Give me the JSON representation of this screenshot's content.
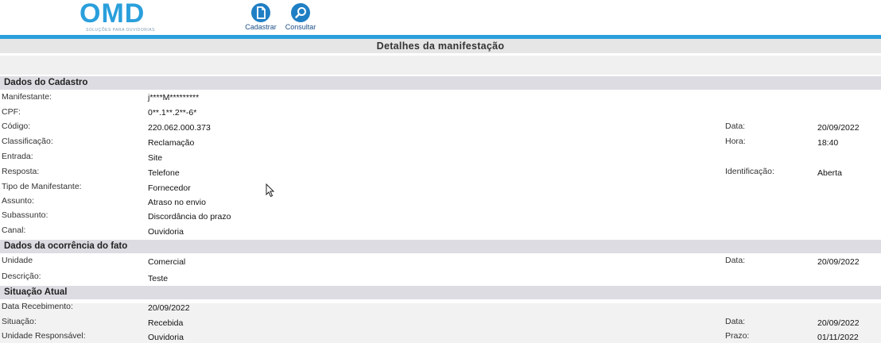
{
  "header": {
    "logo_text": "OMD",
    "logo_subtitle": "SOLUÇÕES PARA OUVIDORIAS",
    "nav": [
      {
        "label": "Cadastrar",
        "icon": "document-icon"
      },
      {
        "label": "Consultar",
        "icon": "search-icon"
      }
    ]
  },
  "colors": {
    "accent": "#2a9fdc",
    "nav_icon": "#1f7fc4",
    "section_bg": "#dcdce2"
  },
  "page_title": "Detalhes da manifestação",
  "sections": {
    "cadastro": {
      "title": "Dados do Cadastro",
      "rows": [
        {
          "label": "Manifestante:",
          "value": "j****M*********"
        },
        {
          "label": "CPF:",
          "value": "0**.1**.2**-6*"
        },
        {
          "label": "Código:",
          "value": "220.062.000.373"
        },
        {
          "label": "Classificação:",
          "value": "Reclamação"
        },
        {
          "label": "Entrada:",
          "value": "Site"
        },
        {
          "label": "Resposta:",
          "value": "Telefone"
        },
        {
          "label": "Tipo de Manifestante:",
          "value": "Fornecedor"
        },
        {
          "label": "Assunto:",
          "value": "Atraso no envio"
        },
        {
          "label": "Subassunto:",
          "value": "Discordância do prazo"
        },
        {
          "label": "Canal:",
          "value": "Ouvidoria"
        }
      ],
      "side": [
        {
          "label": "Data:",
          "value": "20/09/2022"
        },
        {
          "label": "Hora:",
          "value": "18:40"
        },
        {
          "label": "Identificação:",
          "value": "Aberta"
        }
      ]
    },
    "ocorrencia": {
      "title": "Dados da ocorrência do fato",
      "rows": [
        {
          "label": "Unidade",
          "value": "Comercial"
        },
        {
          "label": "Descrição:",
          "value": "Teste"
        }
      ],
      "side": [
        {
          "label": "Data:",
          "value": "20/09/2022"
        }
      ]
    },
    "situacao": {
      "title": "Situação Atual",
      "rows": [
        {
          "label": "Data Recebimento:",
          "value": "20/09/2022"
        },
        {
          "label": "Situação:",
          "value": "Recebida"
        },
        {
          "label": "Unidade Responsável:",
          "value": "Ouvidoria"
        }
      ],
      "side": [
        {
          "label": "Data:",
          "value": "20/09/2022"
        },
        {
          "label": "Prazo:",
          "value": "01/11/2022"
        }
      ]
    }
  }
}
